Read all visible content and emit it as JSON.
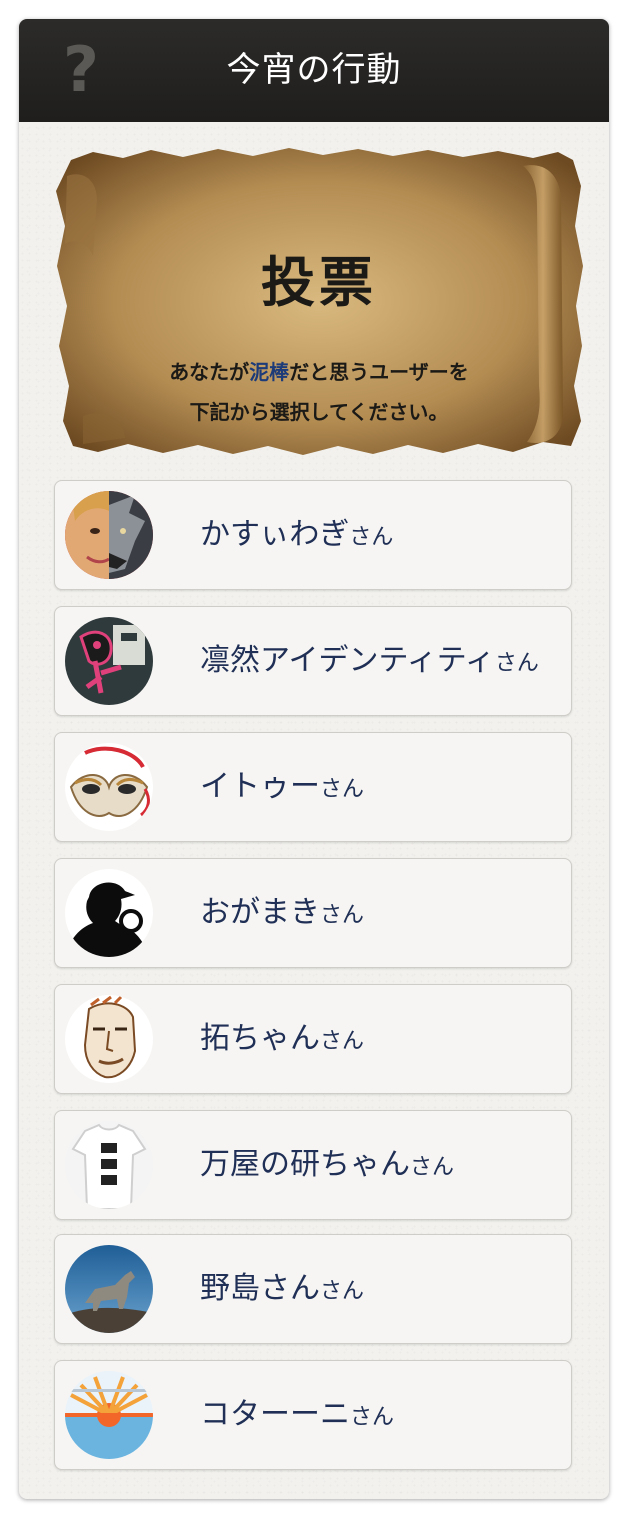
{
  "header": {
    "title": "今宵の行動",
    "help_icon": "question-mark-icon"
  },
  "scroll": {
    "heading": "投票",
    "line1_prefix": "あなたが",
    "line1_highlight": "泥棒",
    "line1_suffix": "だと思うユーザーを",
    "line2": "下記から選択してください。",
    "highlight_color": "#1d3b78"
  },
  "honorific": "さん",
  "candidates": [
    {
      "name": "かすぃわぎ",
      "avatar": "woman-wolf-face-avatar"
    },
    {
      "name": "凛然アイデンティティ",
      "avatar": "pink-figure-avatar"
    },
    {
      "name": "イトゥー",
      "avatar": "masquerade-mask-avatar"
    },
    {
      "name": "おがまき",
      "avatar": "detective-silhouette-avatar"
    },
    {
      "name": "拓ちゃん",
      "avatar": "sketched-face-avatar"
    },
    {
      "name": "万屋の研ちゃん",
      "avatar": "fraud-tshirt-avatar"
    },
    {
      "name": "野島さん",
      "avatar": "howling-wolf-avatar"
    },
    {
      "name": "コターーニ",
      "avatar": "rising-sun-avatar"
    }
  ],
  "colors": {
    "header_bg": "#232220",
    "name_text": "#1f2f55",
    "card_bg": "#f6f5f3"
  }
}
